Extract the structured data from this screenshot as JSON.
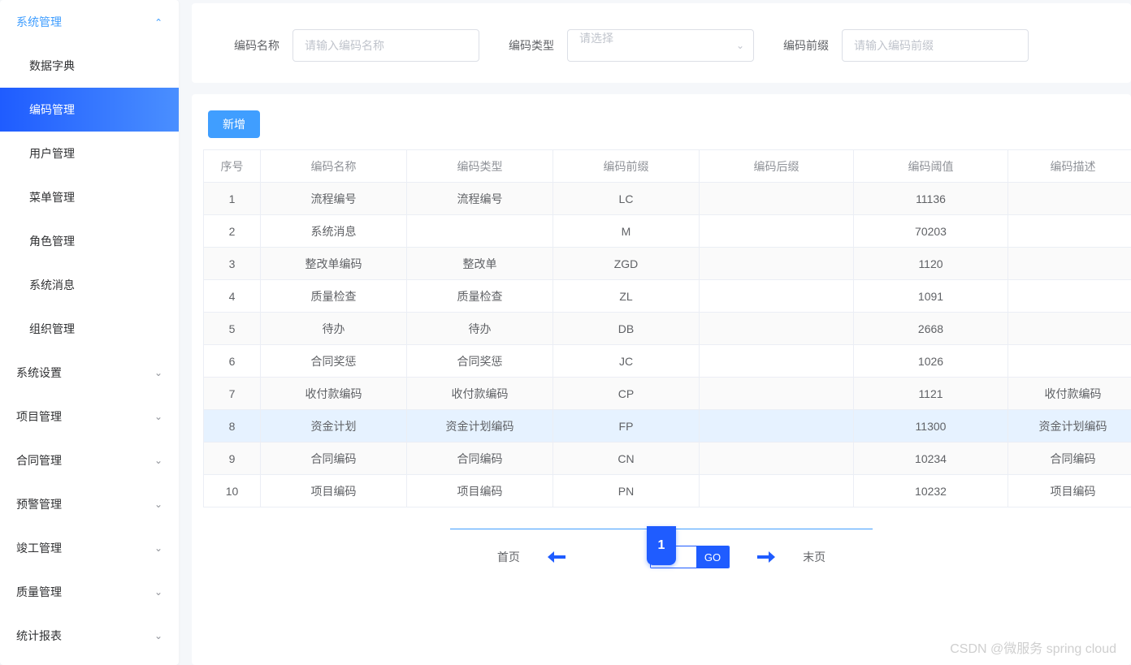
{
  "sidebar": {
    "groups": [
      {
        "label": "系统管理",
        "expanded": true,
        "items": [
          {
            "label": "数据字典",
            "active": false
          },
          {
            "label": "编码管理",
            "active": true
          },
          {
            "label": "用户管理",
            "active": false
          },
          {
            "label": "菜单管理",
            "active": false
          },
          {
            "label": "角色管理",
            "active": false
          },
          {
            "label": "系统消息",
            "active": false
          },
          {
            "label": "组织管理",
            "active": false
          }
        ]
      },
      {
        "label": "系统设置",
        "expanded": false,
        "items": []
      },
      {
        "label": "项目管理",
        "expanded": false,
        "items": []
      },
      {
        "label": "合同管理",
        "expanded": false,
        "items": []
      },
      {
        "label": "预警管理",
        "expanded": false,
        "items": []
      },
      {
        "label": "竣工管理",
        "expanded": false,
        "items": []
      },
      {
        "label": "质量管理",
        "expanded": false,
        "items": []
      },
      {
        "label": "统计报表",
        "expanded": false,
        "items": []
      }
    ]
  },
  "search": {
    "name_label": "编码名称",
    "name_placeholder": "请输入编码名称",
    "type_label": "编码类型",
    "type_placeholder": "请选择",
    "prefix_label": "编码前缀",
    "prefix_placeholder": "请输入编码前缀"
  },
  "toolbar": {
    "add_label": "新增"
  },
  "table": {
    "headers": {
      "seq": "序号",
      "name": "编码名称",
      "type": "编码类型",
      "prefix": "编码前缀",
      "suffix": "编码后缀",
      "threshold": "编码阈值",
      "desc": "编码描述"
    },
    "rows": [
      {
        "seq": "1",
        "name": "流程编号",
        "type": "流程编号",
        "prefix": "LC",
        "suffix": "",
        "threshold": "11136",
        "desc": "",
        "highlight": false
      },
      {
        "seq": "2",
        "name": "系统消息",
        "type": "",
        "prefix": "M",
        "suffix": "",
        "threshold": "70203",
        "desc": "",
        "highlight": false
      },
      {
        "seq": "3",
        "name": "整改单编码",
        "type": "整改单",
        "prefix": "ZGD",
        "suffix": "",
        "threshold": "1120",
        "desc": "",
        "highlight": false
      },
      {
        "seq": "4",
        "name": "质量检查",
        "type": "质量检查",
        "prefix": "ZL",
        "suffix": "",
        "threshold": "1091",
        "desc": "",
        "highlight": false
      },
      {
        "seq": "5",
        "name": "待办",
        "type": "待办",
        "prefix": "DB",
        "suffix": "",
        "threshold": "2668",
        "desc": "",
        "highlight": false
      },
      {
        "seq": "6",
        "name": "合同奖惩",
        "type": "合同奖惩",
        "prefix": "JC",
        "suffix": "",
        "threshold": "1026",
        "desc": "",
        "highlight": false
      },
      {
        "seq": "7",
        "name": "收付款编码",
        "type": "收付款编码",
        "prefix": "CP",
        "suffix": "",
        "threshold": "1121",
        "desc": "收付款编码",
        "highlight": false
      },
      {
        "seq": "8",
        "name": "资金计划",
        "type": "资金计划编码",
        "prefix": "FP",
        "suffix": "",
        "threshold": "11300",
        "desc": "资金计划编码",
        "highlight": true
      },
      {
        "seq": "9",
        "name": "合同编码",
        "type": "合同编码",
        "prefix": "CN",
        "suffix": "",
        "threshold": "10234",
        "desc": "合同编码",
        "highlight": false
      },
      {
        "seq": "10",
        "name": "项目编码",
        "type": "项目编码",
        "prefix": "PN",
        "suffix": "",
        "threshold": "10232",
        "desc": "项目编码",
        "highlight": false
      }
    ]
  },
  "pagination": {
    "first_label": "首页",
    "last_label": "末页",
    "current": "1",
    "input_value": "1",
    "go_label": "GO"
  },
  "watermark": "CSDN @微服务 spring cloud"
}
